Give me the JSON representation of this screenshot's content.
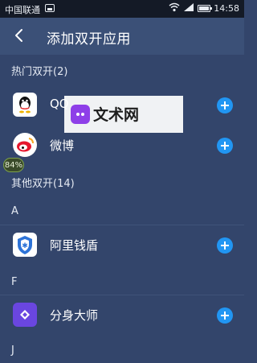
{
  "status_bar": {
    "carrier": "中国联通",
    "time": "14:58"
  },
  "header": {
    "title": "添加双开应用"
  },
  "sections": {
    "hot": "热门双开(2)",
    "other": "其他双开(14)"
  },
  "letters": [
    "A",
    "F",
    "J"
  ],
  "apps": {
    "qq": "QQ",
    "weibo": "微博",
    "aliqiandun": "阿里钱盾",
    "fenshen": "分身大师"
  },
  "watermark": {
    "text": "文术网"
  },
  "badge": {
    "percent": "84%"
  }
}
